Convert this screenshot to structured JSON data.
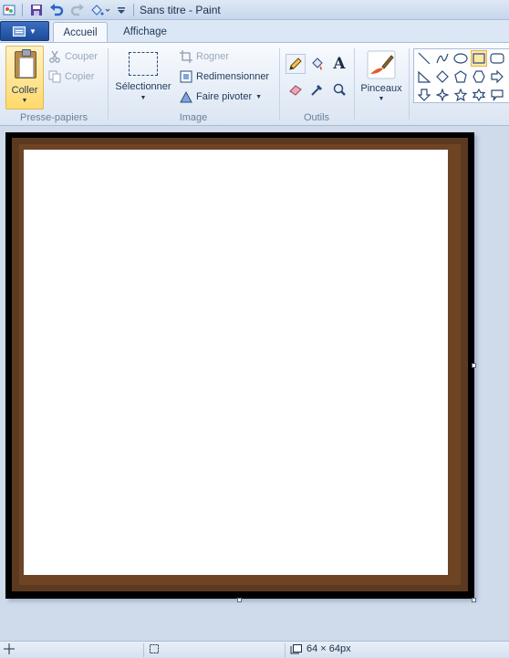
{
  "window": {
    "title": "Sans titre - Paint"
  },
  "quick_access": {
    "items": [
      "paint-app-icon",
      "save-icon",
      "undo-icon",
      "redo-icon",
      "fill-icon",
      "dropdown-icon"
    ]
  },
  "tabs": [
    {
      "label": "Accueil",
      "active": true
    },
    {
      "label": "Affichage",
      "active": false
    }
  ],
  "ribbon": {
    "clipboard": {
      "label": "Presse-papiers",
      "paste": "Coller",
      "cut": "Couper",
      "copy": "Copier"
    },
    "image": {
      "label": "Image",
      "select": "Sélectionner",
      "crop": "Rogner",
      "resize": "Redimensionner",
      "rotate": "Faire pivoter"
    },
    "tools": {
      "label": "Outils",
      "items": [
        "pencil-icon",
        "fill-bucket-icon",
        "text-icon",
        "eraser-icon",
        "color-picker-icon",
        "magnifier-icon"
      ]
    },
    "brushes": {
      "label": "Pinceaux"
    },
    "shapes": {
      "items": [
        "line-shape",
        "curve-shape",
        "oval-shape",
        "rectangle-shape",
        "rounded-rectangle-shape",
        "polygon-shape",
        "triangle-shape",
        "right-triangle-shape",
        "diamond-shape",
        "pentagon-shape",
        "hexagon-shape",
        "right-arrow-shape",
        "left-arrow-shape",
        "down-arrow-shape",
        "four-point-star-shape",
        "five-point-star-shape",
        "six-point-star-shape",
        "callout-shape"
      ]
    }
  },
  "colors": {
    "frame_outer": "#000000",
    "frame_middle": "#5c3a21",
    "frame_inner": "#6e4424",
    "canvas": "#ffffff"
  },
  "statusbar": {
    "selection_size": "",
    "image_size": "64 × 64px"
  }
}
